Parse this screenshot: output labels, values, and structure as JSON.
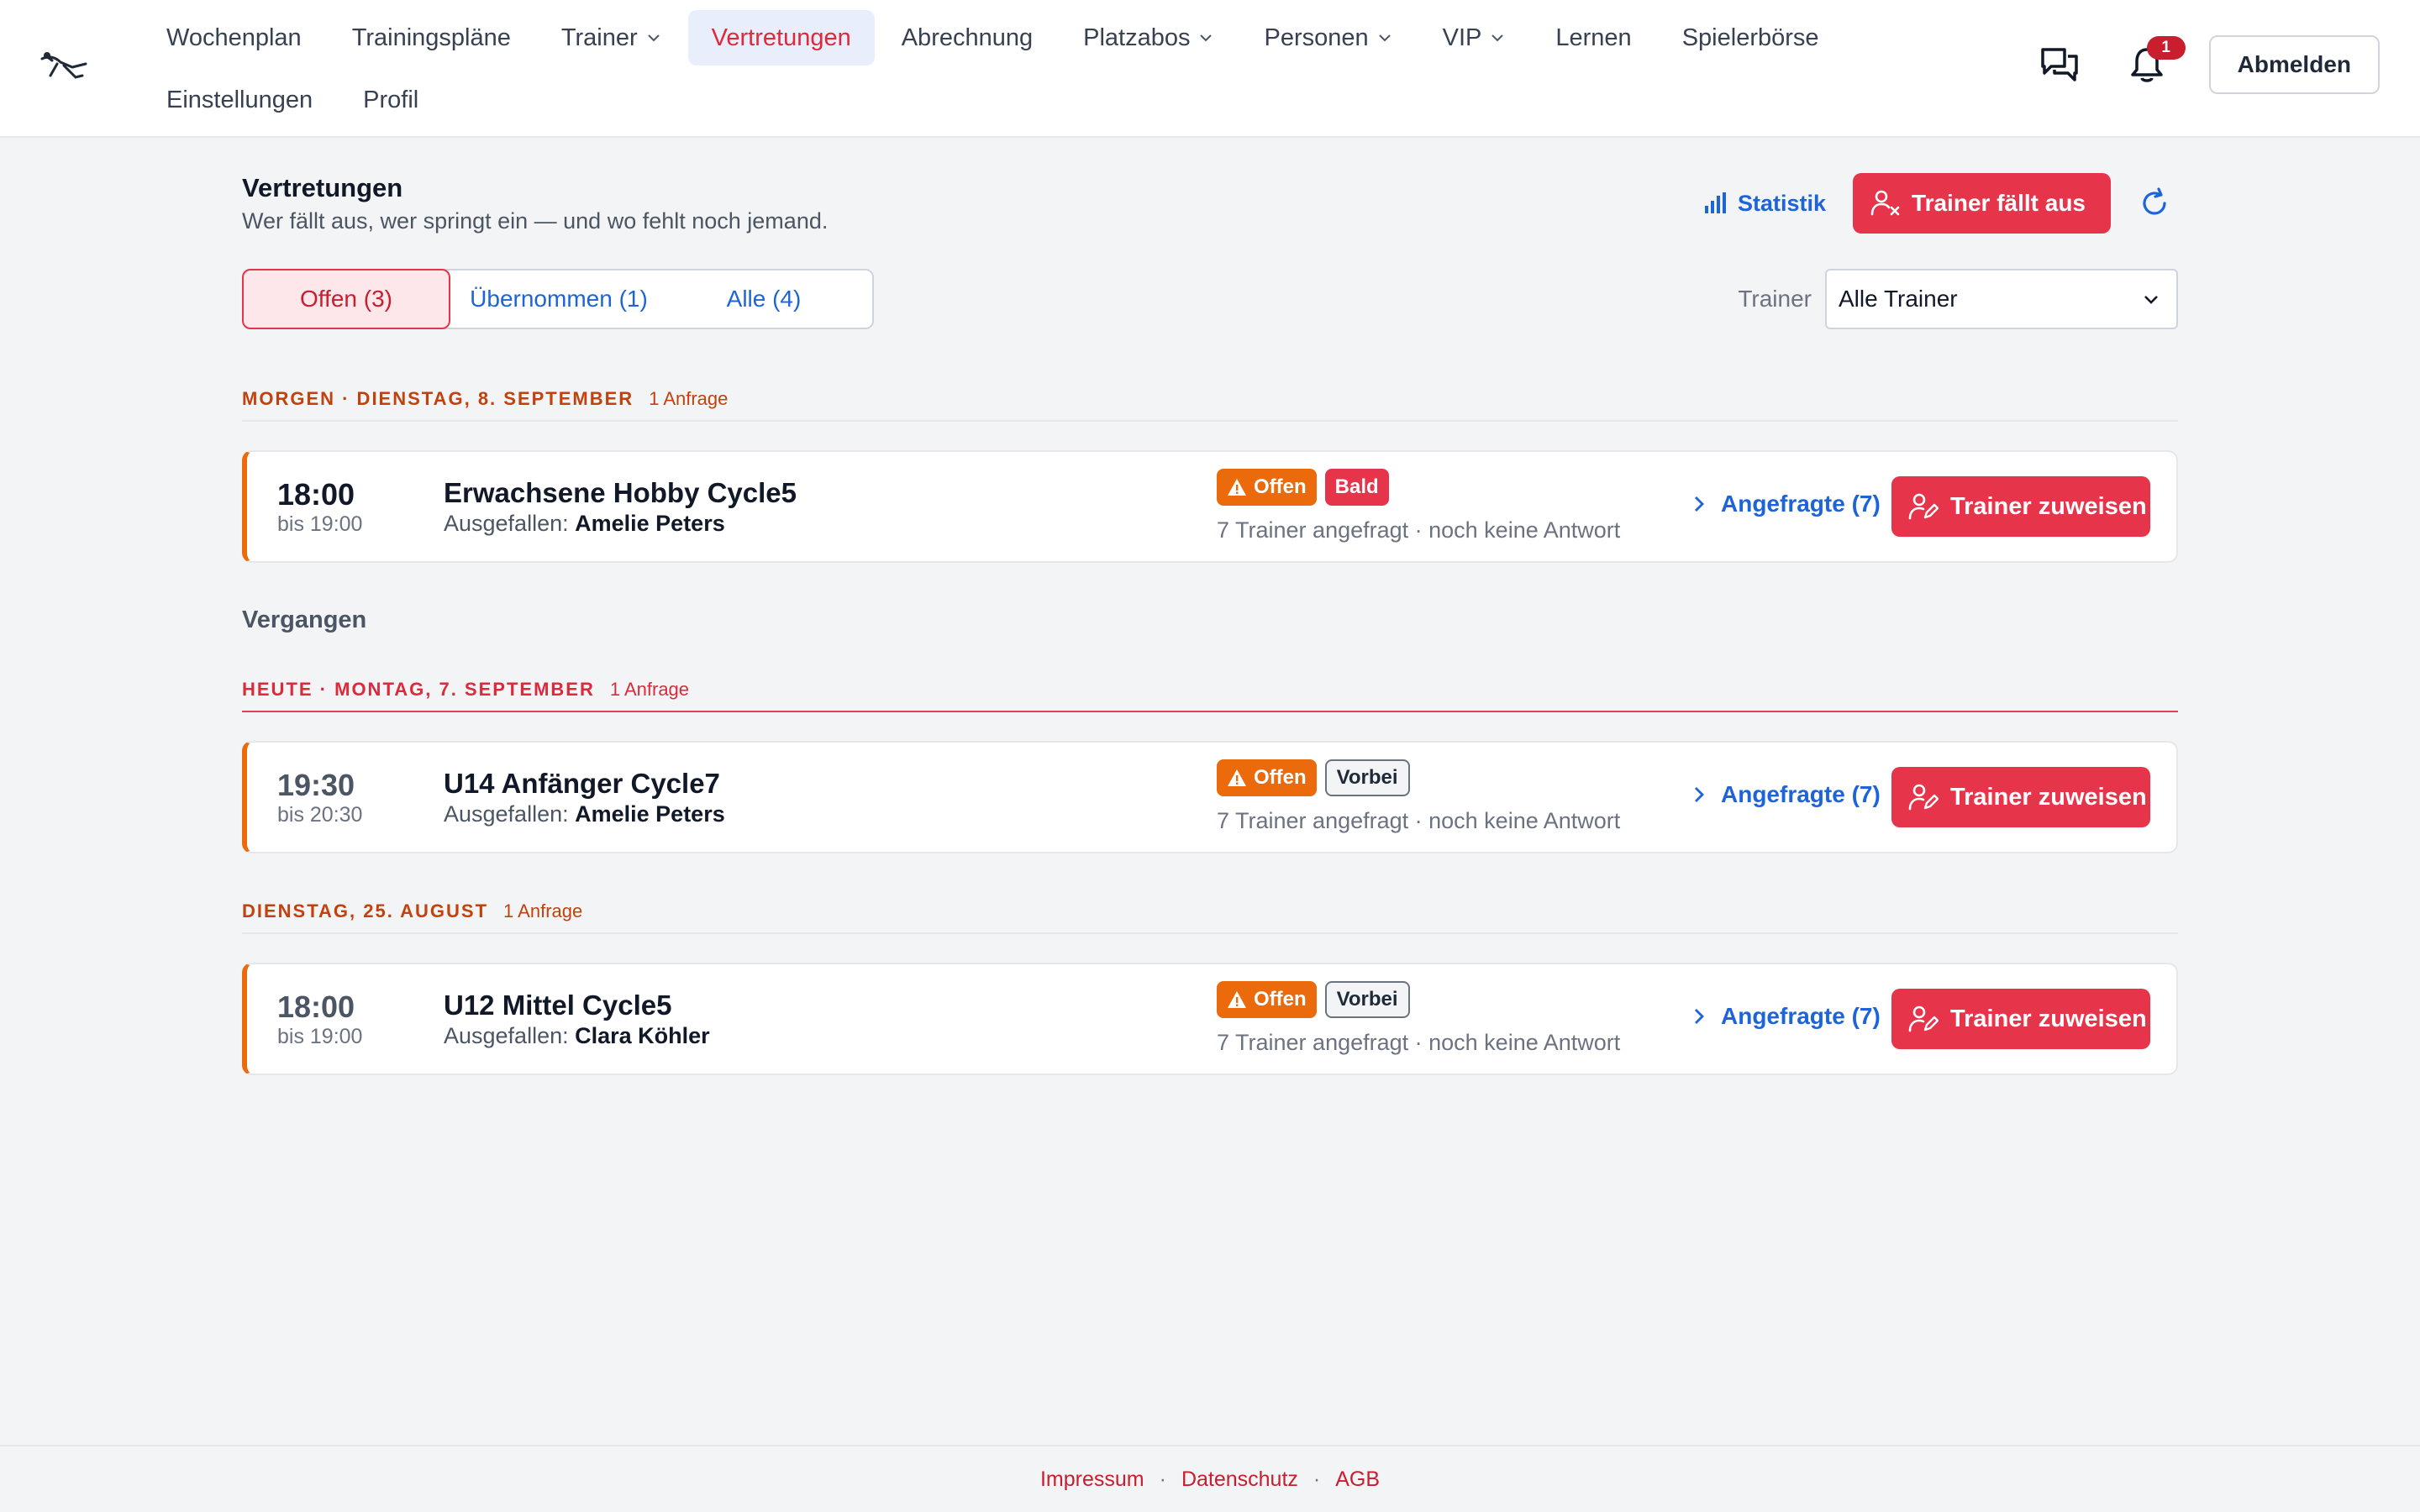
{
  "nav": {
    "items": [
      {
        "label": "Wochenplan"
      },
      {
        "label": "Trainingspläne"
      },
      {
        "label": "Trainer"
      },
      {
        "label": "Vertretungen"
      },
      {
        "label": "Abrechnung"
      },
      {
        "label": "Platzabos"
      },
      {
        "label": "Personen"
      },
      {
        "label": "VIP"
      },
      {
        "label": "Lernen"
      },
      {
        "label": "Spielerbörse"
      },
      {
        "label": "Einstellungen"
      },
      {
        "label": "Profil"
      }
    ],
    "notification_count": "1",
    "logout_label": "Abmelden"
  },
  "page": {
    "title": "Vertretungen",
    "subtitle": "Wer fällt aus, wer springt ein — und wo fehlt noch jemand.",
    "statistik_label": "Statistik",
    "trainer_out_label": "Trainer fällt aus"
  },
  "tabs": [
    {
      "label": "Offen (3)"
    },
    {
      "label": "Übernommen (1)"
    },
    {
      "label": "Alle (4)"
    }
  ],
  "filter": {
    "label": "Trainer",
    "value": "Alle Trainer"
  },
  "groups": [
    {
      "label": "MORGEN · DIENSTAG, 8. SEPTEMBER",
      "count": "1 Anfrage"
    },
    {
      "label": "HEUTE · MONTAG, 7. SEPTEMBER",
      "count": "1 Anfrage"
    },
    {
      "label": "DIENSTAG, 25. AUGUST",
      "count": "1 Anfrage"
    }
  ],
  "past_label": "Vergangen",
  "cards": [
    {
      "time": "18:00",
      "until": "bis 19:00",
      "title": "Erwachsene Hobby Cycle5",
      "absent_prefix": "Ausgefallen:",
      "absent_name": "Amelie Peters",
      "badge_status": "Offen",
      "badge_extra": "Bald",
      "request_info": "7 Trainer angefragt · noch keine Antwort",
      "asked_label": "Angefragte (7)",
      "assign_label": "Trainer zuweisen"
    },
    {
      "time": "19:30",
      "until": "bis 20:30",
      "title": "U14 Anfänger Cycle7",
      "absent_prefix": "Ausgefallen:",
      "absent_name": "Amelie Peters",
      "badge_status": "Offen",
      "badge_extra": "Vorbei",
      "request_info": "7 Trainer angefragt · noch keine Antwort",
      "asked_label": "Angefragte (7)",
      "assign_label": "Trainer zuweisen"
    },
    {
      "time": "18:00",
      "until": "bis 19:00",
      "title": "U12 Mittel Cycle5",
      "absent_prefix": "Ausgefallen:",
      "absent_name": "Clara Köhler",
      "badge_status": "Offen",
      "badge_extra": "Vorbei",
      "request_info": "7 Trainer angefragt · noch keine Antwort",
      "asked_label": "Angefragte (7)",
      "assign_label": "Trainer zuweisen"
    }
  ],
  "footer": {
    "impressum": "Impressum",
    "datenschutz": "Datenschutz",
    "agb": "AGB",
    "separator": "·"
  },
  "colors": {
    "accent_red": "#e6354a",
    "link_blue": "#1d64d8",
    "status_orange": "#ea6a0c"
  }
}
